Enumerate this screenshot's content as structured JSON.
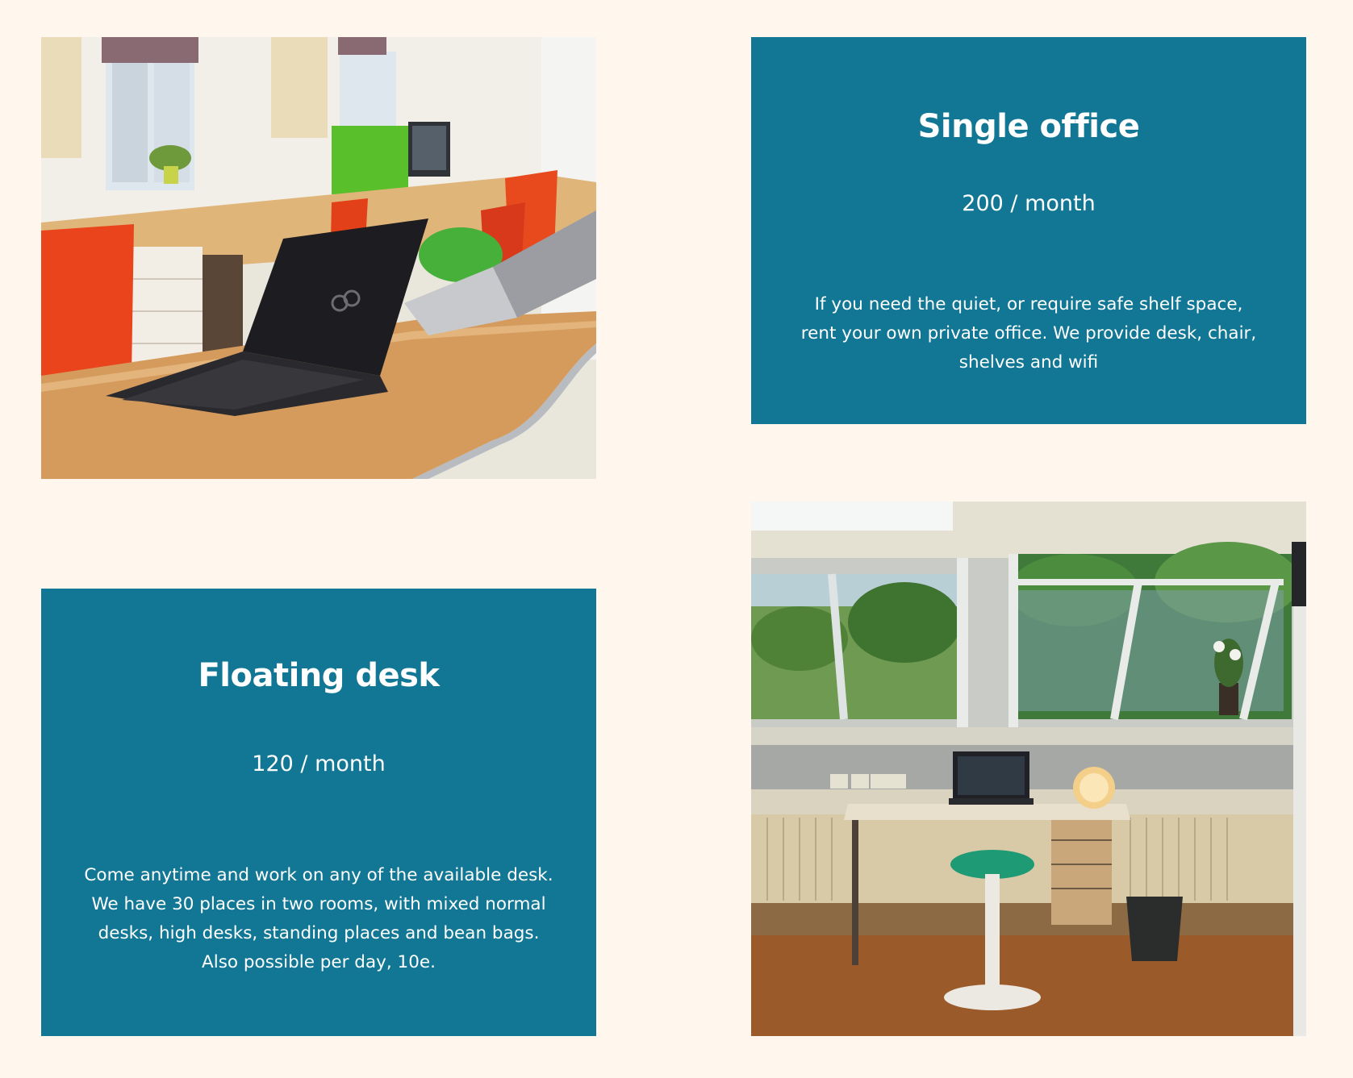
{
  "cards": {
    "single_office": {
      "title": "Single office",
      "price": "200 / month",
      "description": "If you need the quiet, or require safe shelf space, rent your own private office. We provide desk, chair, shelves and wifi"
    },
    "floating_desk": {
      "title": "Floating desk",
      "price": "120 / month",
      "description": "Come anytime and work on any of the available desk. We have 30 places in two rooms, with mixed normal desks, high desks, standing places and bean bags. Also possible per day, 10e."
    }
  },
  "colors": {
    "page_background": "#fff6ee",
    "card_background": "#117794",
    "card_text": "#ffffff"
  }
}
